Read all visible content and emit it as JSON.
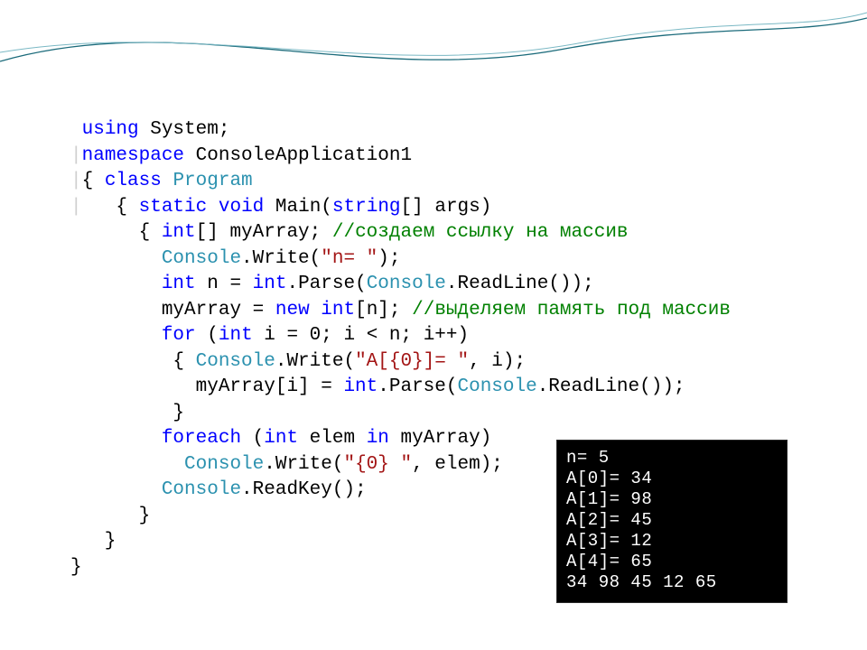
{
  "code": {
    "l1_kw_using": "using",
    "l1_type": " System",
    "l1_sc": ";",
    "l2_gut": "|",
    "l2_kw_ns": "namespace",
    "l2_nsname": " ConsoleApplication1",
    "l3_gut": "|",
    "l3_ob": "{ ",
    "l3_kw_cls": "class",
    "l3_typ": " Program",
    "l4_gut": "|",
    "l4_ob": "   { ",
    "l4_kw_stat": "static",
    "l4_sp1": " ",
    "l4_kw_void": "void",
    "l4_main": " Main(",
    "l4_kw_str": "string",
    "l4_arr": "[] args)",
    "l5_ob": "      { ",
    "l5_kw_int": "int",
    "l5_decl": "[] myArray; ",
    "l5_cmt": "//создаем ссылку на массив",
    "l6_pad": "        ",
    "l6_cons": "Console",
    "l6_wr": ".Write(",
    "l6_str": "\"n= \"",
    "l6_cb": ");",
    "l7_pad": "        ",
    "l7_kw_int": "int",
    "l7_neq": " n = ",
    "l7_kw_int2": "int",
    "l7_parse": ".Parse(",
    "l7_cons": "Console",
    "l7_rl": ".ReadLine());",
    "l8_pad": "        ",
    "l8_ma": "myArray = ",
    "l8_kw_new": "new",
    "l8_sp": " ",
    "l8_kw_int": "int",
    "l8_n": "[n]; ",
    "l8_cmt": "//выделяем память под массив",
    "l9_pad": "        ",
    "l9_kw_for": "for",
    "l9_a": " (",
    "l9_kw_int": "int",
    "l9_b": " i = 0; i < n; i++)",
    "l10_pad": "         { ",
    "l10_cons": "Console",
    "l10_wr": ".Write(",
    "l10_str": "\"A[{0}]= \"",
    "l10_cb": ", i);",
    "l11_pad": "           ",
    "l11_txt1": "myArray[i] = ",
    "l11_kw_int": "int",
    "l11_parse": ".Parse(",
    "l11_cons": "Console",
    "l11_rl": ".ReadLine());",
    "l12_pad": "         }",
    "l13_pad": "        ",
    "l13_kw_fe": "foreach",
    "l13_a": " (",
    "l13_kw_int": "int",
    "l13_b": " elem ",
    "l13_kw_in": "in",
    "l13_c": " myArray)",
    "l14_pad": "          ",
    "l14_cons": "Console",
    "l14_wr": ".Write(",
    "l14_str": "\"{0} \"",
    "l14_cb": ", elem);",
    "l15_pad": "        ",
    "l15_cons": "Console",
    "l15_rk": ".ReadKey();",
    "l16_pad": "      }",
    "l17_pad": "   }",
    "l18_pad": "}"
  },
  "console": {
    "l1": "n= 5",
    "l2": "A[0]= 34",
    "l3": "A[1]= 98",
    "l4": "A[2]= 45",
    "l5": "A[3]= 12",
    "l6": "A[4]= 65",
    "l7": "34 98 45 12 65"
  }
}
